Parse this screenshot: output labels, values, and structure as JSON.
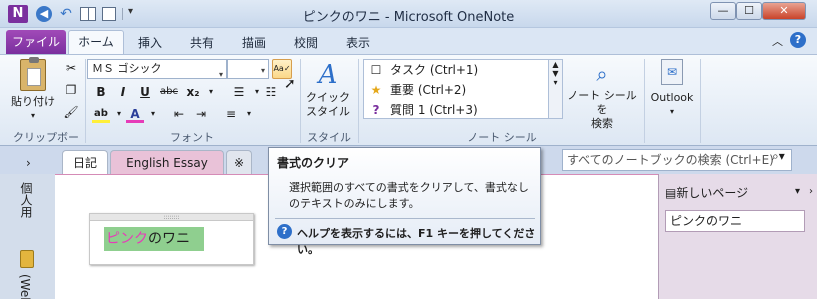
{
  "window": {
    "title": "ピンクのワニ - Microsoft OneNote",
    "app_icon": "N",
    "minimize": "—",
    "maximize": "☐",
    "close": "✕"
  },
  "ribbon_tabs": {
    "file": "ファイル",
    "tabs": [
      "ホーム",
      "挿入",
      "共有",
      "描画",
      "校閲",
      "表示"
    ],
    "active": "ホーム"
  },
  "clipboard": {
    "paste": "貼り付け",
    "group": "クリップボード"
  },
  "font": {
    "font_name": "ＭＳ ゴシック",
    "font_size": "",
    "group": "フォント",
    "bold": "B",
    "italic": "I",
    "underline": "U",
    "strike": "abc",
    "subscript": "x₂",
    "highlight": "ab",
    "font_color": "A"
  },
  "style": {
    "button": "クイック\nスタイル",
    "group": "スタイル",
    "label_1": "クイック",
    "label_2": "スタイル"
  },
  "tags": {
    "items": [
      "タスク (Ctrl+1)",
      "重要 (Ctrl+2)",
      "質問 1 (Ctrl+3)"
    ],
    "find_1": "ノート シールを",
    "find_2": "検索",
    "group": "ノート シール"
  },
  "outlook": {
    "label": "Outlook"
  },
  "notebook": {
    "section_tabs": [
      "日記",
      "English Essay"
    ],
    "new_section": "※",
    "search_placeholder": "すべてのノートブックの検索 (Ctrl+E)",
    "sidebar_notebook": "個人用",
    "sidebar_web": "(Web)",
    "new_page": "新しいページ",
    "pages": [
      "ピンクのワニ"
    ]
  },
  "note": {
    "text_pink": "ピンク",
    "text_rest": "のワニ"
  },
  "tooltip": {
    "title": "書式のクリア",
    "body": "選択範囲のすべての書式をクリアして、書式なしのテキストのみにします。",
    "help": "ヘルプを表示するには、F1 キーを押してください。"
  },
  "colors": {
    "file_tab": "#7a2f9e",
    "highlight": "#8fcf8f",
    "pink_text": "#e63bb8",
    "section_tab_active": "#e9c2d8"
  }
}
